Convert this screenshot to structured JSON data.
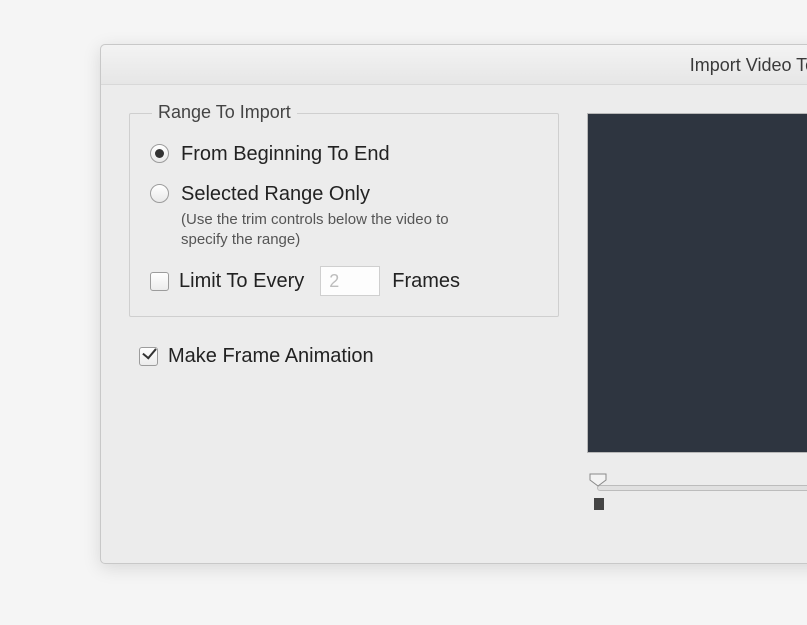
{
  "window": {
    "title": "Import Video To L"
  },
  "range_group": {
    "legend": "Range To Import",
    "option_beginning": "From Beginning To End",
    "option_selected_range": "Selected Range Only",
    "selected_range_hint": "(Use the trim controls below the video to specify the range)",
    "selected": "beginning"
  },
  "limit": {
    "checkbox_label": "Limit To Every",
    "value": "2",
    "unit": "Frames",
    "checked": false
  },
  "make_frame": {
    "label": "Make Frame Animation",
    "checked": true
  }
}
